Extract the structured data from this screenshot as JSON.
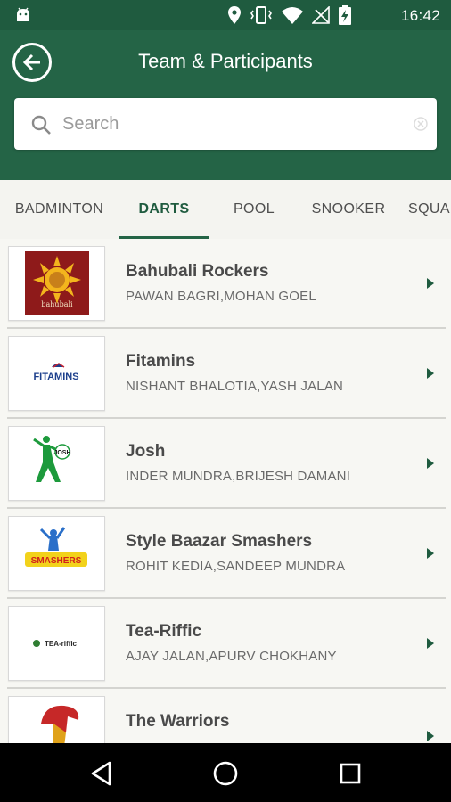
{
  "status_bar": {
    "time": "16:42",
    "icons": [
      "android-icon",
      "location-icon",
      "vibrate-icon",
      "wifi-icon",
      "no-signal-icon",
      "battery-charging-icon"
    ]
  },
  "app_bar": {
    "title": "Team & Participants",
    "back_icon": "back-arrow-circle-icon"
  },
  "search": {
    "placeholder": "Search",
    "value": ""
  },
  "tabs": [
    {
      "label": "BADMINTON",
      "active": false
    },
    {
      "label": "DARTS",
      "active": true
    },
    {
      "label": "POOL",
      "active": false
    },
    {
      "label": "SNOOKER",
      "active": false
    },
    {
      "label": "SQUA",
      "active": false
    }
  ],
  "teams": [
    {
      "name": "Bahubali Rockers",
      "members": "PAWAN BAGRI,MOHAN GOEL",
      "logo": "bahubali-logo",
      "logo_text": "bahubali"
    },
    {
      "name": "Fitamins",
      "members": "NISHANT BHALOTIA,YASH JALAN",
      "logo": "fitamins-logo",
      "logo_text": "FITAMINS"
    },
    {
      "name": "Josh",
      "members": "INDER MUNDRA,BRIJESH DAMANI",
      "logo": "josh-logo",
      "logo_text": "JOSH"
    },
    {
      "name": "Style Baazar Smashers",
      "members": "ROHIT KEDIA,SANDEEP MUNDRA",
      "logo": "smashers-logo",
      "logo_text": "SMASHERS"
    },
    {
      "name": "Tea-Riffic",
      "members": "AJAY JALAN,APURV CHOKHANY",
      "logo": "tea-riffic-logo",
      "logo_text": "TEA-riffic"
    },
    {
      "name": "The Warriors",
      "members": "",
      "logo": "warriors-logo",
      "logo_text": ""
    }
  ],
  "colors": {
    "status_bar": "#1f5b3f",
    "app_bar": "#246446",
    "accent": "#1f5b3f",
    "list_bg": "#f7f7f3"
  },
  "nav_bar": {
    "buttons": [
      "back-triangle-icon",
      "home-circle-icon",
      "recents-square-icon"
    ]
  }
}
